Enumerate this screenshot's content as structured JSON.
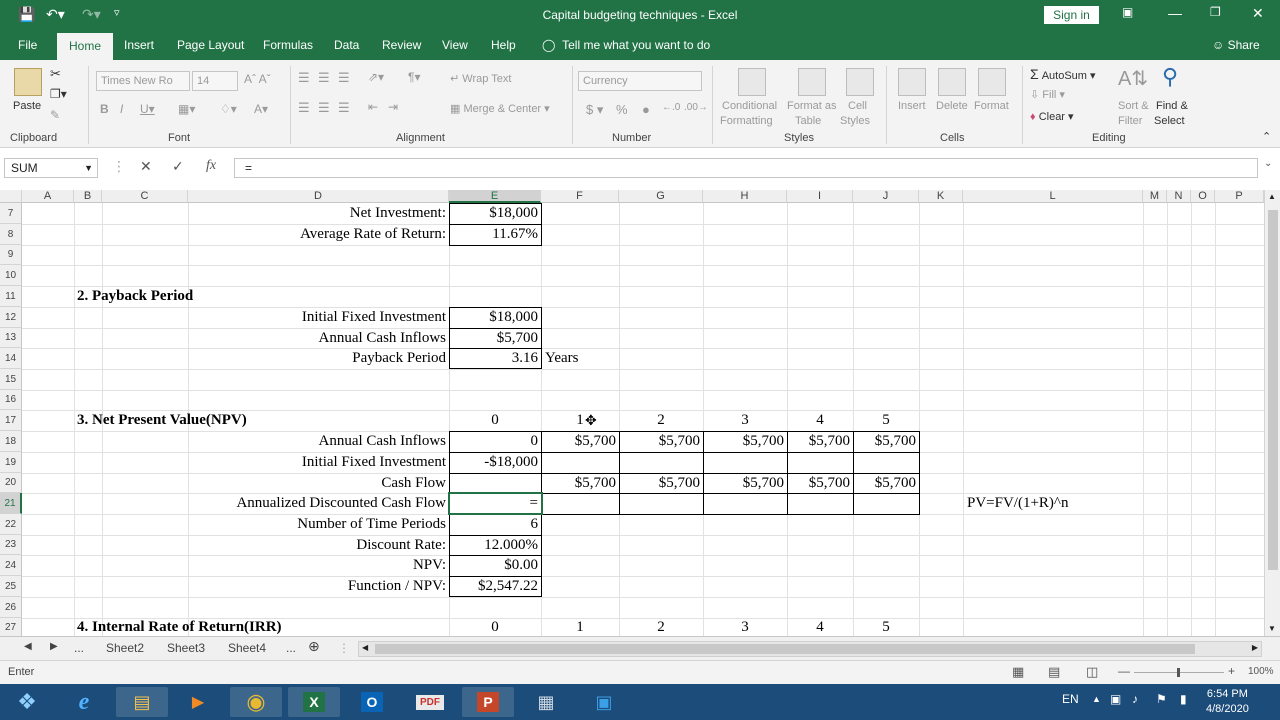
{
  "window": {
    "title": "Capital budgeting techniques  -  Excel",
    "sign_in": "Sign in"
  },
  "menu": {
    "tabs": [
      "File",
      "Home",
      "Insert",
      "Page Layout",
      "Formulas",
      "Data",
      "Review",
      "View",
      "Help"
    ],
    "active": "Home",
    "tell_me": "Tell me what you want to do",
    "share": "Share"
  },
  "ribbon": {
    "paste": "Paste",
    "font_name": "Times New Ro",
    "font_size": "14",
    "wrap_text": "Wrap Text",
    "merge_center": "Merge & Center",
    "number_format": "Currency",
    "conditional_formatting": "Conditional",
    "conditional_formatting_2": "Formatting",
    "format_as_table": "Format as",
    "format_as_table_2": "Table",
    "cell_styles": "Cell",
    "cell_styles_2": "Styles",
    "insert": "Insert",
    "delete": "Delete",
    "format": "Format",
    "autosum": "AutoSum",
    "fill": "Fill",
    "clear": "Clear",
    "sort_filter": "Sort &",
    "sort_filter_2": "Filter",
    "find_select": "Find &",
    "find_select_2": "Select",
    "groups": {
      "clipboard": "Clipboard",
      "font": "Font",
      "alignment": "Alignment",
      "number": "Number",
      "styles": "Styles",
      "cells": "Cells",
      "editing": "Editing"
    }
  },
  "formula_bar": {
    "name_box": "SUM",
    "formula": "="
  },
  "grid": {
    "columns": [
      "A",
      "B",
      "C",
      "D",
      "E",
      "F",
      "G",
      "H",
      "I",
      "J",
      "K",
      "L",
      "M",
      "N",
      "O",
      "P"
    ],
    "rows": [
      "7",
      "8",
      "9",
      "10",
      "11",
      "12",
      "13",
      "14",
      "15",
      "16",
      "17",
      "18",
      "19",
      "20",
      "21",
      "22",
      "23",
      "24",
      "25",
      "26",
      "27"
    ],
    "selected_column": "E",
    "selected_row": "21",
    "cells": {
      "d7": "Net Investment:",
      "e7": "$18,000",
      "d8": "Average Rate of Return:",
      "e8": "11.67%",
      "b11": "2. Payback Period",
      "d12": "Initial Fixed Investment",
      "e12": "$18,000",
      "d13": "Annual Cash Inflows",
      "e13": "$5,700",
      "d14": "Payback Period",
      "e14": "3.16",
      "f14": "Years",
      "b17": "3. Net Present Value(NPV)",
      "row17_years": [
        "0",
        "1",
        "2",
        "3",
        "4",
        "5"
      ],
      "d18": "Annual Cash Inflows",
      "row18": [
        "0",
        "$5,700",
        "$5,700",
        "$5,700",
        "$5,700",
        "$5,700"
      ],
      "d19": "Initial Fixed Investment",
      "e19": "-$18,000",
      "d20": "Cash Flow",
      "row20": [
        "$5,700",
        "$5,700",
        "$5,700",
        "$5,700",
        "$5,700"
      ],
      "d21": "Annualized Discounted Cash Flow",
      "e21": "=",
      "l21": "PV=FV/(1+R)^n",
      "d22": "Number of Time Periods",
      "e22": "6",
      "d23": "Discount Rate:",
      "e23": "12.000%",
      "d24": "NPV:",
      "e24": "$0.00",
      "d25": "Function / NPV:",
      "e25": "$2,547.22",
      "b27": "4. Internal Rate of Return(IRR)",
      "row27_years": [
        "0",
        "1",
        "2",
        "3",
        "4",
        "5"
      ]
    }
  },
  "sheets": {
    "ellipsis": "...",
    "tabs": [
      "Sheet2",
      "Sheet3",
      "Sheet4"
    ],
    "more": "..."
  },
  "status": {
    "mode": "Enter",
    "zoom": "100%"
  },
  "taskbar": {
    "language": "EN",
    "time": "6:54 PM",
    "date": "4/8/2020"
  },
  "colors": {
    "excel_green": "#217346",
    "taskbar_blue": "#1c4c7a"
  }
}
